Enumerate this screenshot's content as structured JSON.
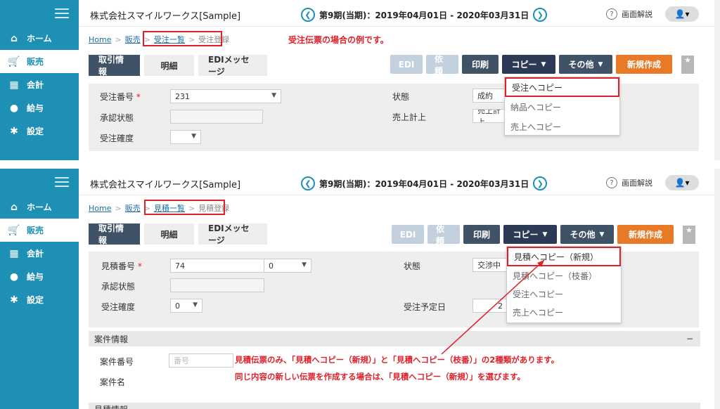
{
  "shot1": {
    "sidebar": [
      {
        "label": "ホーム",
        "icon": "home-icon"
      },
      {
        "label": "販売",
        "icon": "cart-icon"
      },
      {
        "label": "会計",
        "icon": "calculator-icon"
      },
      {
        "label": "給与",
        "icon": "money-bag-icon"
      },
      {
        "label": "設定",
        "icon": "gear-icon"
      }
    ],
    "company": "株式会社スマイルワークス[Sample]",
    "period": "第9期(当期)：2019年04月01日 - 2020年03月31日",
    "help": "画面解説",
    "breadcrumb": [
      "Home",
      "販売",
      "受注一覧",
      "受注登録"
    ],
    "annotation": "受注伝票の場合の例です。",
    "tabs": [
      "取引情報",
      "明細",
      "EDIメッセージ"
    ],
    "buttons": {
      "edi": "EDI",
      "request": "依頼",
      "print": "印刷",
      "copy": "コピー",
      "other": "その他",
      "new": "新規作成"
    },
    "fields": {
      "order_no_label": "受注番号",
      "order_no": "231",
      "approval_label": "承認状態",
      "certainty_label": "受注確度",
      "status_label": "状態",
      "status": "成約",
      "sales_label": "売上計上",
      "sales": "売上計上"
    },
    "menu": [
      "受注へコピー",
      "納品へコピー",
      "売上へコピー"
    ]
  },
  "shot2": {
    "company": "株式会社スマイルワークス[Sample]",
    "period": "第9期(当期)：2019年04月01日 - 2020年03月31日",
    "help": "画面解説",
    "breadcrumb": [
      "Home",
      "販売",
      "見積一覧",
      "見積登録"
    ],
    "tabs": [
      "取引情報",
      "明細",
      "EDIメッセージ"
    ],
    "buttons": {
      "edi": "EDI",
      "request": "依頼",
      "print": "印刷",
      "copy": "コピー",
      "other": "その他",
      "new": "新規作成"
    },
    "fields": {
      "est_no_label": "見積番号",
      "est_no": "74",
      "branch": "0",
      "approval_label": "承認状態",
      "certainty_label": "受注確度",
      "certainty": "0",
      "status_label": "状態",
      "status": "交渉中",
      "order_date_label": "受注予定日",
      "order_date": "2"
    },
    "menu": [
      "見積へコピー（新規）",
      "見積へコピー（枝番）",
      "受注へコピー",
      "売上へコピー"
    ],
    "section_project": "案件情報",
    "project_no_label": "案件番号",
    "project_no_placeholder": "番号",
    "project_name_label": "案件名",
    "section_estimate": "見積情報",
    "annotation_line1": "見積伝票のみ、「見積へコピー（新規）」と「見積へコピー（枝番）」の2種類があります。",
    "annotation_line2": "同じ内容の新しい伝票を作成する場合は、「見積へコピー（新規）」を選びます。"
  }
}
